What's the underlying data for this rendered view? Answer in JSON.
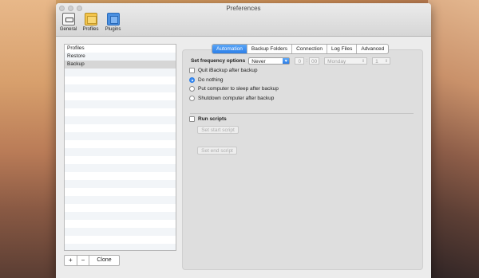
{
  "window": {
    "title": "Preferences"
  },
  "toolbar": {
    "items": [
      {
        "label": "General",
        "icon": "general-icon"
      },
      {
        "label": "Profiles",
        "icon": "folder-icon"
      },
      {
        "label": "Plugins",
        "icon": "plugins-icon"
      }
    ]
  },
  "profiles": {
    "items": [
      "Profiles",
      "Restore",
      "Backup"
    ],
    "selected": "Backup"
  },
  "list_buttons": {
    "add": "+",
    "remove": "−",
    "clone": "Clone"
  },
  "tabs": [
    "Automation",
    "Backup Folders",
    "Connection",
    "Log Files",
    "Advanced"
  ],
  "active_tab": "Automation",
  "automation": {
    "frequency_label": "Set frequency options",
    "frequency_value": "Never",
    "hour": "0",
    "time_separator": ":",
    "minute": "00",
    "day": "Monday",
    "day_number": "1",
    "quit_label": "Quit iBackup after backup",
    "radio_do_nothing": "Do nothing",
    "radio_sleep": "Put computer to sleep after backup",
    "radio_shutdown": "Shutdown computer after backup",
    "run_scripts_label": "Run scripts",
    "start_script_button": "Set start script",
    "end_script_button": "Set end script"
  },
  "colors": {
    "accent": "#2d7fe8",
    "selection": "#d6d6d6"
  }
}
